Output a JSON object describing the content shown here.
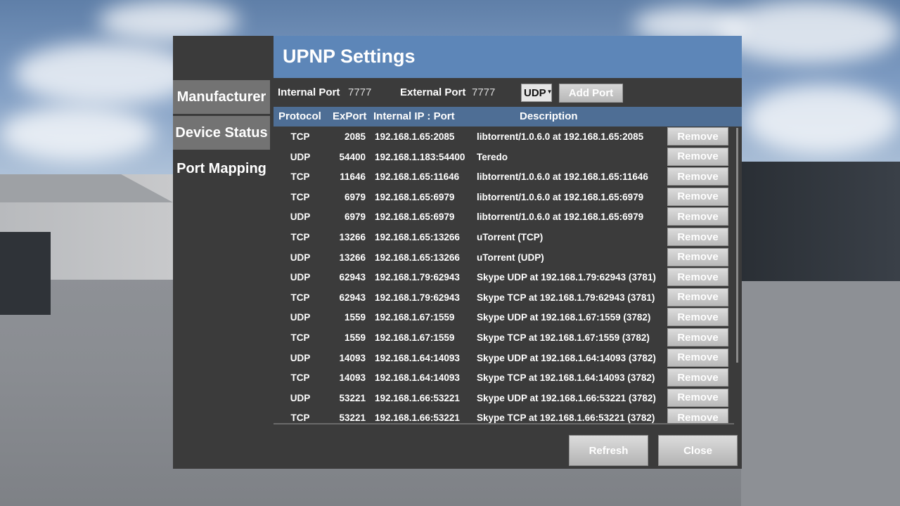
{
  "dialog": {
    "title": "UPNP Settings"
  },
  "tabs": [
    {
      "label": "Manufacturer",
      "state": "inactive"
    },
    {
      "label": "Device Status",
      "state": "inactive"
    },
    {
      "label": "Port Mapping",
      "state": "active"
    }
  ],
  "toolbar": {
    "internal_port_label": "Internal Port",
    "internal_port_value": "7777",
    "external_port_label": "External Port",
    "external_port_value": "7777",
    "protocol_selected": "UDP",
    "add_port_label": "Add Port"
  },
  "table": {
    "headers": {
      "protocol": "Protocol",
      "export": "ExPort",
      "internal": "Internal IP : Port",
      "description": "Description"
    },
    "remove_label": "Remove",
    "rows": [
      {
        "protocol": "TCP",
        "export": "2085",
        "internal": "192.168.1.65:2085",
        "description": "libtorrent/1.0.6.0 at 192.168.1.65:2085"
      },
      {
        "protocol": "UDP",
        "export": "54400",
        "internal": "192.168.1.183:54400",
        "description": "Teredo"
      },
      {
        "protocol": "TCP",
        "export": "11646",
        "internal": "192.168.1.65:11646",
        "description": "libtorrent/1.0.6.0 at 192.168.1.65:11646"
      },
      {
        "protocol": "TCP",
        "export": "6979",
        "internal": "192.168.1.65:6979",
        "description": "libtorrent/1.0.6.0 at 192.168.1.65:6979"
      },
      {
        "protocol": "UDP",
        "export": "6979",
        "internal": "192.168.1.65:6979",
        "description": "libtorrent/1.0.6.0 at 192.168.1.65:6979"
      },
      {
        "protocol": "TCP",
        "export": "13266",
        "internal": "192.168.1.65:13266",
        "description": "uTorrent (TCP)"
      },
      {
        "protocol": "UDP",
        "export": "13266",
        "internal": "192.168.1.65:13266",
        "description": "uTorrent (UDP)"
      },
      {
        "protocol": "UDP",
        "export": "62943",
        "internal": "192.168.1.79:62943",
        "description": "Skype UDP at 192.168.1.79:62943 (3781)"
      },
      {
        "protocol": "TCP",
        "export": "62943",
        "internal": "192.168.1.79:62943",
        "description": "Skype TCP at 192.168.1.79:62943 (3781)"
      },
      {
        "protocol": "UDP",
        "export": "1559",
        "internal": "192.168.1.67:1559",
        "description": "Skype UDP at 192.168.1.67:1559 (3782)"
      },
      {
        "protocol": "TCP",
        "export": "1559",
        "internal": "192.168.1.67:1559",
        "description": "Skype TCP at 192.168.1.67:1559 (3782)"
      },
      {
        "protocol": "UDP",
        "export": "14093",
        "internal": "192.168.1.64:14093",
        "description": "Skype UDP at 192.168.1.64:14093 (3782)"
      },
      {
        "protocol": "TCP",
        "export": "14093",
        "internal": "192.168.1.64:14093",
        "description": "Skype TCP at 192.168.1.64:14093 (3782)"
      },
      {
        "protocol": "UDP",
        "export": "53221",
        "internal": "192.168.1.66:53221",
        "description": "Skype UDP at 192.168.1.66:53221 (3782)"
      },
      {
        "protocol": "TCP",
        "export": "53221",
        "internal": "192.168.1.66:53221",
        "description": "Skype TCP at 192.168.1.66:53221 (3782)"
      }
    ]
  },
  "footer": {
    "refresh_label": "Refresh",
    "close_label": "Close"
  },
  "colors": {
    "title_bar": "#5d86b8",
    "header_row": "#4e6e95",
    "panel": "#3b3b3b",
    "inactive_tab": "#737373"
  }
}
